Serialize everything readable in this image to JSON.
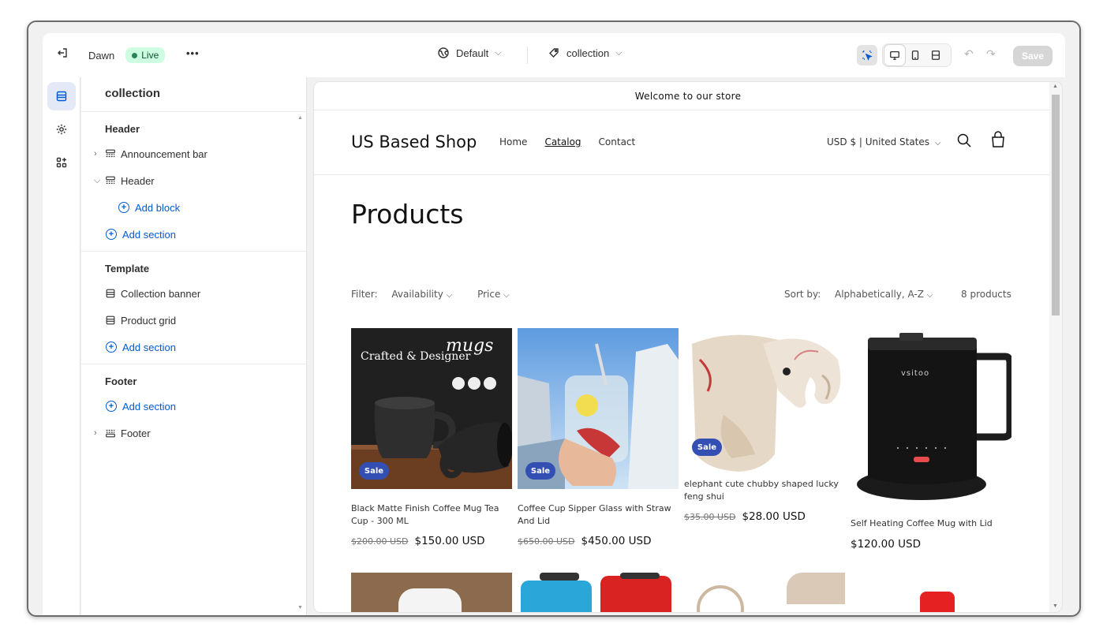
{
  "topbar": {
    "theme_name": "Dawn",
    "live_label": "Live",
    "more_label": "•••",
    "context_label": "Default",
    "template_label": "collection",
    "save_label": "Save"
  },
  "panel": {
    "title": "collection",
    "groups": [
      {
        "title": "Header",
        "rows": [
          {
            "label": "Announcement bar"
          },
          {
            "label": "Header"
          },
          {
            "label": "Add block"
          },
          {
            "label": "Add section"
          }
        ]
      },
      {
        "title": "Template",
        "rows": [
          {
            "label": "Collection banner"
          },
          {
            "label": "Product grid"
          },
          {
            "label": "Add section"
          }
        ]
      },
      {
        "title": "Footer",
        "rows": [
          {
            "label": "Add section"
          },
          {
            "label": "Footer"
          }
        ]
      }
    ]
  },
  "store": {
    "announcement": "Welcome to our store",
    "shop_name": "US Based Shop",
    "nav": [
      "Home",
      "Catalog",
      "Contact"
    ],
    "currency": "USD $ | United States",
    "page_title": "Products",
    "filter_label": "Filter:",
    "filter_availability": "Availability",
    "filter_price": "Price",
    "sort_label": "Sort by:",
    "sort_value": "Alphabetically, A-Z",
    "count": "8 products",
    "sale_badge": "Sale",
    "products": [
      {
        "name": "Black Matte Finish Coffee Mug Tea Cup - 300 ML",
        "old": "$200.00 USD",
        "price": "$150.00 USD"
      },
      {
        "name": "Coffee Cup Sipper Glass with Straw And Lid",
        "old": "$650.00 USD",
        "price": "$450.00 USD"
      },
      {
        "name": "elephant cute chubby shaped lucky feng shui",
        "old": "$35.00 USD",
        "price": "$28.00 USD"
      },
      {
        "name": "Self Heating Coffee Mug with Lid",
        "price": "$120.00 USD"
      }
    ],
    "mug_text_1": "mugs",
    "mug_text_2": "Crafted & Designer",
    "brand_text": "vsitoo"
  }
}
